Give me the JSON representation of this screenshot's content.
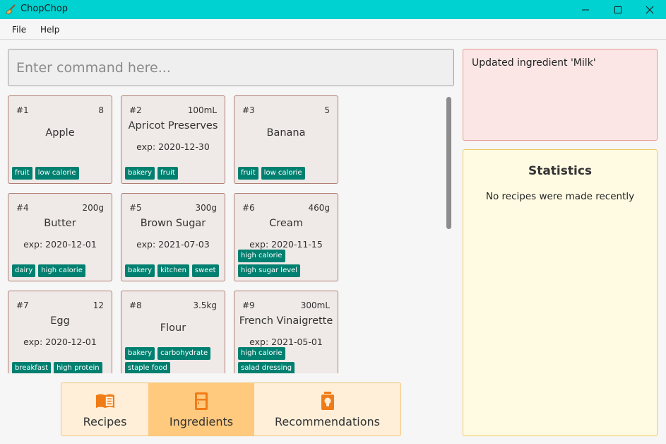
{
  "window": {
    "title": "ChopChop"
  },
  "menu": {
    "file": "File",
    "help": "Help"
  },
  "command": {
    "placeholder": "Enter command here..."
  },
  "ingredients": [
    {
      "index": "#1",
      "quantity": "8",
      "name": "Apple",
      "expiry": "",
      "tags": [
        "fruit",
        "low calorie"
      ]
    },
    {
      "index": "#2",
      "quantity": "100mL",
      "name": "Apricot Preserves",
      "expiry": "exp: 2020-12-30",
      "tags": [
        "bakery",
        "fruit"
      ]
    },
    {
      "index": "#3",
      "quantity": "5",
      "name": "Banana",
      "expiry": "",
      "tags": [
        "fruit",
        "low calorie"
      ]
    },
    {
      "index": "#4",
      "quantity": "200g",
      "name": "Butter",
      "expiry": "exp: 2020-12-01",
      "tags": [
        "dairy",
        "high calorie"
      ]
    },
    {
      "index": "#5",
      "quantity": "300g",
      "name": "Brown Sugar",
      "expiry": "exp: 2021-07-03",
      "tags": [
        "bakery",
        "kitchen",
        "sweet"
      ]
    },
    {
      "index": "#6",
      "quantity": "460g",
      "name": "Cream",
      "expiry": "exp: 2020-11-15",
      "tags": [
        "high calorie",
        "high sugar level"
      ]
    },
    {
      "index": "#7",
      "quantity": "12",
      "name": "Egg",
      "expiry": "exp: 2020-12-01",
      "tags": [
        "breakfast",
        "high protein"
      ]
    },
    {
      "index": "#8",
      "quantity": "3.5kg",
      "name": "Flour",
      "expiry": "",
      "tags": [
        "bakery",
        "carbohydrate",
        "staple food"
      ]
    },
    {
      "index": "#9",
      "quantity": "300mL",
      "name": "French Vinaigrette",
      "expiry": "exp: 2021-05-01",
      "tags": [
        "high calorie",
        "salad dressing"
      ]
    }
  ],
  "tabs": {
    "recipes": "Recipes",
    "ingredients": "Ingredients",
    "recommendations": "Recommendations",
    "active": "ingredients"
  },
  "result": {
    "message": "Updated ingredient 'Milk'"
  },
  "statistics": {
    "title": "Statistics",
    "empty_message": "No recipes were made recently"
  },
  "colors": {
    "titlebar": "#00d1d1",
    "tag": "#008070",
    "card_border": "#b07f75",
    "tab_active": "#ffc97e",
    "tab_icon": "#f07c17",
    "result_bg": "#fbe6e5",
    "stats_bg": "#fffbe3"
  },
  "icons": {
    "app": "broom-icon",
    "recipes": "open-book-icon",
    "ingredients": "fridge-icon",
    "recommendations": "lightbulb-icon"
  }
}
